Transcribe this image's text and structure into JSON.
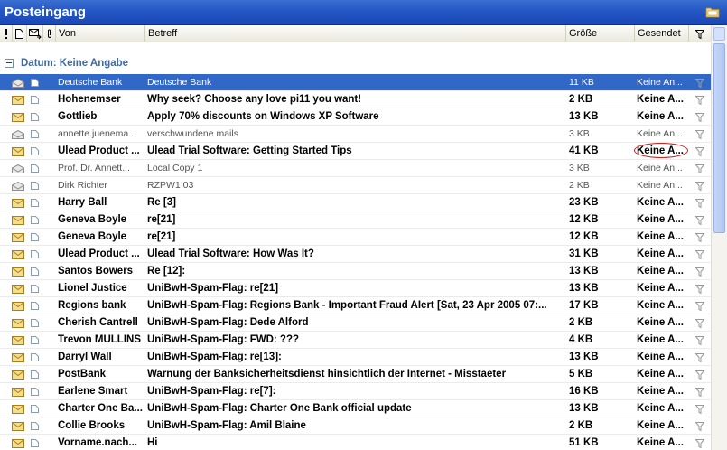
{
  "window": {
    "title": "Posteingang"
  },
  "columns": {
    "from": "Von",
    "subject": "Betreff",
    "size": "Größe",
    "sent": "Gesendet"
  },
  "group": {
    "label": "Datum: Keine Angabe"
  },
  "colors": {
    "accent": "#3167c6",
    "title_bar": "#2457c5",
    "group_text": "#3e6aa6",
    "highlight_circle": "#c8201e"
  },
  "messages": [
    {
      "from": "Deutsche Bank",
      "subject": "Deutsche Bank",
      "size": "11 KB",
      "sent": "Keine An...",
      "read": true,
      "selected": true
    },
    {
      "from": "Hohenemser",
      "subject": "Why seek? Choose any love pi11 you want!",
      "size": "2 KB",
      "sent": "Keine A...",
      "read": false
    },
    {
      "from": "Gottlieb",
      "subject": "Apply 70% discounts on Windows XP Software",
      "size": "13 KB",
      "sent": "Keine A...",
      "read": false
    },
    {
      "from": "annette.juenema...",
      "subject": "verschwundene mails",
      "size": "3 KB",
      "sent": "Keine An...",
      "read": true
    },
    {
      "from": "Ulead Product ...",
      "subject": "Ulead Trial Software: Getting Started Tips",
      "size": "41 KB",
      "sent": "Keine A...",
      "read": false,
      "circled": true
    },
    {
      "from": "Prof. Dr. Annett...",
      "subject": "Local Copy 1",
      "size": "3 KB",
      "sent": "Keine An...",
      "read": true
    },
    {
      "from": "Dirk Richter",
      "subject": "RZPW1 03",
      "size": "2 KB",
      "sent": "Keine An...",
      "read": true
    },
    {
      "from": "Harry Ball",
      "subject": "Re [3]",
      "size": "23 KB",
      "sent": "Keine A...",
      "read": false
    },
    {
      "from": "Geneva Boyle",
      "subject": "re[21]",
      "size": "12 KB",
      "sent": "Keine A...",
      "read": false
    },
    {
      "from": "Geneva Boyle",
      "subject": "re[21]",
      "size": "12 KB",
      "sent": "Keine A...",
      "read": false
    },
    {
      "from": "Ulead Product ...",
      "subject": "Ulead Trial Software: How Was It?",
      "size": "31 KB",
      "sent": "Keine A...",
      "read": false
    },
    {
      "from": "Santos Bowers",
      "subject": "Re [12]:",
      "size": "13 KB",
      "sent": "Keine A...",
      "read": false
    },
    {
      "from": "Lionel Justice",
      "subject": "UniBwH-Spam-Flag: re[21]",
      "size": "13 KB",
      "sent": "Keine A...",
      "read": false
    },
    {
      "from": "Regions bank",
      "subject": "UniBwH-Spam-Flag: Regions Bank - Important Fraud AIert [Sat, 23 Apr 2005 07:...",
      "size": "17 KB",
      "sent": "Keine A...",
      "read": false
    },
    {
      "from": "Cherish Cantrell",
      "subject": "UniBwH-Spam-Flag: Dede Alford",
      "size": "2 KB",
      "sent": "Keine A...",
      "read": false
    },
    {
      "from": "Trevon MULLINS",
      "subject": "UniBwH-Spam-Flag: FWD: ???",
      "size": "4 KB",
      "sent": "Keine A...",
      "read": false
    },
    {
      "from": "Darryl Wall",
      "subject": "UniBwH-Spam-Flag: re[13]:",
      "size": "13 KB",
      "sent": "Keine A...",
      "read": false
    },
    {
      "from": "PostBank",
      "subject": "Warnung der Banksicherheitsdienst hinsichtlich der Internet - Misstaeter",
      "size": "5 KB",
      "sent": "Keine A...",
      "read": false
    },
    {
      "from": "Earlene Smart",
      "subject": "UniBwH-Spam-Flag: re[7]:",
      "size": "16 KB",
      "sent": "Keine A...",
      "read": false
    },
    {
      "from": "Charter One Ba...",
      "subject": "UniBwH-Spam-Flag: Charter One Bank official update",
      "size": "13 KB",
      "sent": "Keine A...",
      "read": false
    },
    {
      "from": "Collie Brooks",
      "subject": "UniBwH-Spam-Flag: Amil Blaine",
      "size": "2 KB",
      "sent": "Keine A...",
      "read": false
    },
    {
      "from": "Vorname.nach...",
      "subject": "Hi",
      "size": "51 KB",
      "sent": "Keine A...",
      "read": false
    }
  ]
}
